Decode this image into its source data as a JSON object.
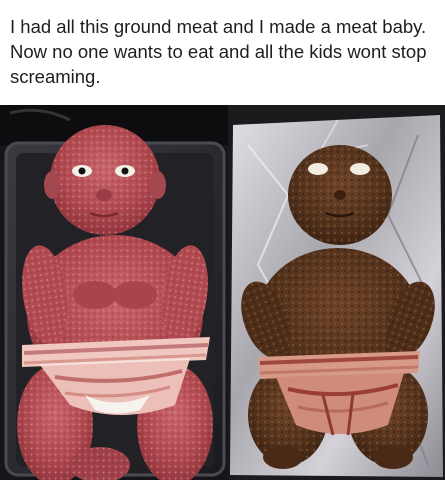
{
  "post": {
    "caption": "I had all this ground meat and I made a meat baby. Now no one wants to eat and all the kids wont stop screaming."
  },
  "photos": [
    {
      "subject": "raw ground meat shaped like a baby wearing a bacon diaper on a baking tray"
    },
    {
      "subject": "cooked meatloaf baby wearing a bacon diaper on aluminum foil"
    }
  ],
  "colors": {
    "raw_meat": "#b8535a",
    "cooked_meat": "#5a3520",
    "bacon": "#e8b8b0",
    "foil": "#c9c7cc",
    "tray": "#2a2a2e"
  }
}
